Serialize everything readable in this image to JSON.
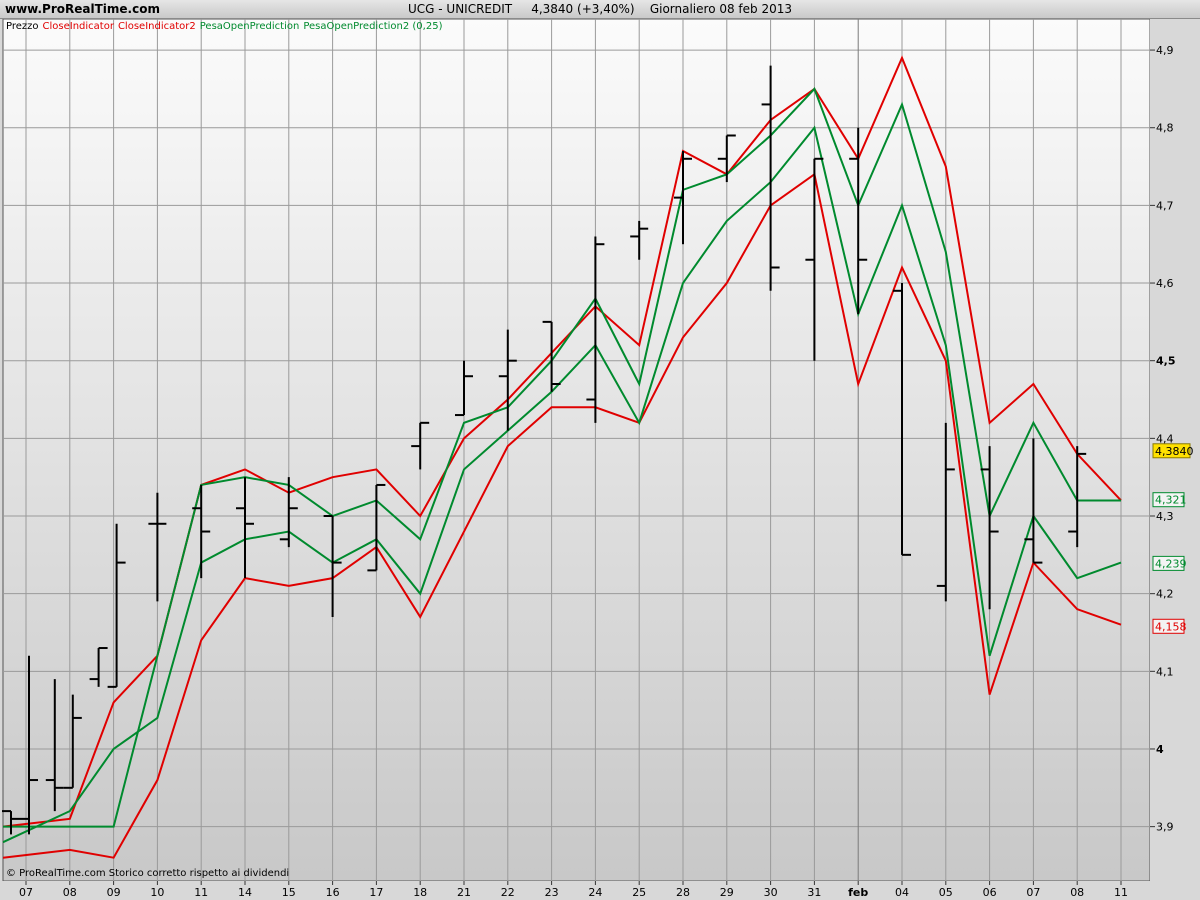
{
  "app": {
    "site": "www.ProRealTime.com"
  },
  "header": {
    "symbol": "UCG - UNICREDIT",
    "price": "4,3840 (+3,40%)",
    "period": "Giornaliero  08 feb 2013"
  },
  "legend": [
    {
      "label": "Prezzo",
      "color": "#000000"
    },
    {
      "label": "CloseIndicator",
      "color": "#e00000"
    },
    {
      "label": "CloseIndicator2",
      "color": "#e00000"
    },
    {
      "label": "PesaOpenPrediction",
      "color": "#008a2e"
    },
    {
      "label": "PesaOpenPrediction2 (0,25)",
      "color": "#008a2e"
    }
  ],
  "footer": {
    "note": "© ProRealTime.com  Storico corretto rispetto ai dividendi"
  },
  "colors": {
    "price": "#000000",
    "red": "#e00000",
    "green": "#008a2e",
    "badge_yellow": "#ffe100",
    "badge_red": "#e00000",
    "badge_green": "#008a2e",
    "grid": "#9a9a9a",
    "month_line": "#7a7a7a"
  },
  "chart_data": {
    "type": "ohlc",
    "y_range": [
      3.83,
      4.94
    ],
    "y_ticks": [
      "3,9",
      "4",
      "4,1",
      "4,2",
      "4,3",
      "4,4",
      "4,5",
      "4,6",
      "4,7",
      "4,8",
      "4,9"
    ],
    "y_tick_values": [
      3.9,
      4.0,
      4.1,
      4.2,
      4.3,
      4.4,
      4.5,
      4.6,
      4.7,
      4.8,
      4.9
    ],
    "bold_ticks": [
      "4",
      "4,5"
    ],
    "x_labels": [
      "07",
      "08",
      "09",
      "10",
      "11",
      "14",
      "15",
      "16",
      "17",
      "18",
      "21",
      "22",
      "23",
      "24",
      "25",
      "28",
      "29",
      "30",
      "31",
      "feb",
      "04",
      "05",
      "06",
      "07",
      "08",
      "11"
    ],
    "month_separator": "feb",
    "ohlc": [
      {
        "date": "07",
        "open": 3.92,
        "high": 3.92,
        "low": 3.89,
        "close": 3.91
      },
      {
        "date": "07",
        "open": 3.91,
        "high": 4.12,
        "low": 3.89,
        "close": 3.96
      },
      {
        "date": "08",
        "open": 3.96,
        "high": 4.09,
        "low": 3.92,
        "close": 3.95
      },
      {
        "date": "08",
        "open": 3.95,
        "high": 4.07,
        "low": 3.95,
        "close": 4.04
      },
      {
        "date": "09",
        "open": 4.09,
        "high": 4.13,
        "low": 4.08,
        "close": 4.13
      },
      {
        "date": "09",
        "open": 4.08,
        "high": 4.29,
        "low": 4.08,
        "close": 4.24
      },
      {
        "date": "10",
        "open": 4.29,
        "high": 4.33,
        "low": 4.19,
        "close": 4.29
      },
      {
        "date": "11",
        "open": 4.31,
        "high": 4.34,
        "low": 4.22,
        "close": 4.28
      },
      {
        "date": "14",
        "open": 4.31,
        "high": 4.35,
        "low": 4.22,
        "close": 4.29
      },
      {
        "date": "15",
        "open": 4.27,
        "high": 4.35,
        "low": 4.26,
        "close": 4.31
      },
      {
        "date": "16",
        "open": 4.3,
        "high": 4.3,
        "low": 4.17,
        "close": 4.24
      },
      {
        "date": "17",
        "open": 4.23,
        "high": 4.34,
        "low": 4.23,
        "close": 4.34
      },
      {
        "date": "18",
        "open": 4.39,
        "high": 4.42,
        "low": 4.36,
        "close": 4.42
      },
      {
        "date": "21",
        "open": 4.43,
        "high": 4.5,
        "low": 4.43,
        "close": 4.48
      },
      {
        "date": "22",
        "open": 4.48,
        "high": 4.54,
        "low": 4.41,
        "close": 4.5
      },
      {
        "date": "23",
        "open": 4.55,
        "high": 4.55,
        "low": 4.46,
        "close": 4.47
      },
      {
        "date": "24",
        "open": 4.45,
        "high": 4.66,
        "low": 4.42,
        "close": 4.65
      },
      {
        "date": "25",
        "open": 4.66,
        "high": 4.68,
        "low": 4.63,
        "close": 4.67
      },
      {
        "date": "28",
        "open": 4.71,
        "high": 4.77,
        "low": 4.65,
        "close": 4.76
      },
      {
        "date": "29",
        "open": 4.76,
        "high": 4.79,
        "low": 4.73,
        "close": 4.79
      },
      {
        "date": "30",
        "open": 4.83,
        "high": 4.88,
        "low": 4.59,
        "close": 4.62
      },
      {
        "date": "31",
        "open": 4.63,
        "high": 4.76,
        "low": 4.5,
        "close": 4.76
      },
      {
        "date": "feb",
        "open": 4.76,
        "high": 4.8,
        "low": 4.56,
        "close": 4.63
      },
      {
        "date": "04",
        "open": 4.59,
        "high": 4.6,
        "low": 4.25,
        "close": 4.25
      },
      {
        "date": "05",
        "open": 4.21,
        "high": 4.42,
        "low": 4.19,
        "close": 4.36
      },
      {
        "date": "06",
        "open": 4.36,
        "high": 4.39,
        "low": 4.18,
        "close": 4.28
      },
      {
        "date": "07",
        "open": 4.27,
        "high": 4.4,
        "low": 4.24,
        "close": 4.24
      },
      {
        "date": "08",
        "open": 4.28,
        "high": 4.39,
        "low": 4.26,
        "close": 4.38
      }
    ],
    "series": [
      {
        "name": "CloseIndicator",
        "color": "#e00000",
        "values": [
          3.9,
          3.91,
          4.06,
          4.12,
          4.34,
          4.36,
          4.33,
          4.35,
          4.36,
          4.3,
          4.4,
          4.45,
          4.51,
          4.57,
          4.52,
          4.77,
          4.74,
          4.81,
          4.85,
          4.76,
          4.89,
          4.75,
          4.42,
          4.47,
          4.38,
          4.32
        ]
      },
      {
        "name": "CloseIndicator2",
        "color": "#e00000",
        "values": [
          3.86,
          3.87,
          3.86,
          3.96,
          4.14,
          4.22,
          4.21,
          4.22,
          4.26,
          4.17,
          4.28,
          4.39,
          4.44,
          4.44,
          4.42,
          4.53,
          4.6,
          4.7,
          4.74,
          4.47,
          4.62,
          4.5,
          4.07,
          4.24,
          4.18,
          4.16
        ]
      },
      {
        "name": "PesaOpenPrediction",
        "color": "#008a2e",
        "values": [
          3.9,
          3.9,
          3.9,
          4.12,
          4.34,
          4.35,
          4.34,
          4.3,
          4.32,
          4.27,
          4.42,
          4.44,
          4.5,
          4.58,
          4.47,
          4.72,
          4.74,
          4.79,
          4.85,
          4.7,
          4.83,
          4.64,
          4.3,
          4.42,
          4.32,
          4.32
        ]
      },
      {
        "name": "PesaOpenPrediction2 (0,25)",
        "color": "#008a2e",
        "values": [
          3.88,
          3.92,
          4.0,
          4.04,
          4.24,
          4.27,
          4.28,
          4.24,
          4.27,
          4.2,
          4.36,
          4.41,
          4.46,
          4.52,
          4.42,
          4.6,
          4.68,
          4.73,
          4.8,
          4.56,
          4.7,
          4.52,
          4.12,
          4.3,
          4.22,
          4.24
        ]
      }
    ],
    "last_values": [
      {
        "label": "4,3840",
        "value": 4.384,
        "style": "yellow"
      },
      {
        "label": "4,321",
        "value": 4.321,
        "style": "green"
      },
      {
        "label": "4,239",
        "value": 4.239,
        "style": "green"
      },
      {
        "label": "4,158",
        "value": 4.158,
        "style": "red"
      }
    ]
  }
}
